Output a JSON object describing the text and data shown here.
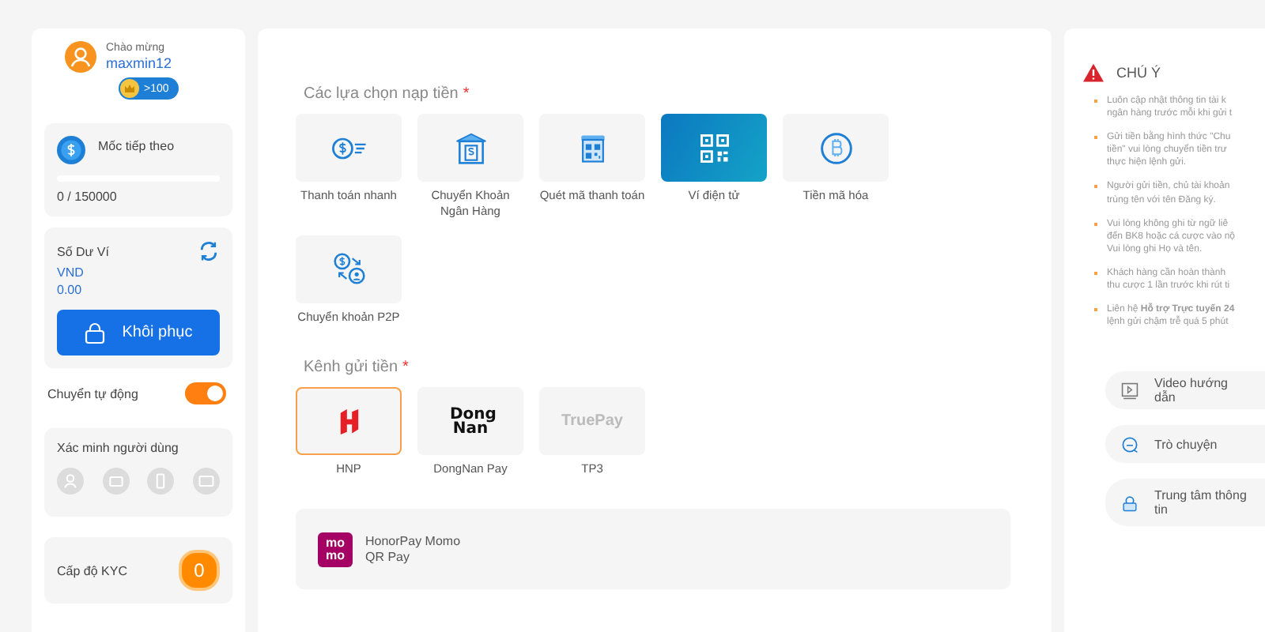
{
  "user": {
    "greeting": "Chào mừng",
    "username": "maxmin12",
    "badge": ">100"
  },
  "milestone": {
    "label": "Mốc tiếp theo",
    "level": 0,
    "progress": "0 / 150000"
  },
  "wallet": {
    "label": "Số Dư Ví",
    "currency": "VND",
    "amount": "0.00",
    "button": "Khôi phục"
  },
  "auto_transfer": {
    "label": "Chuyển tự động",
    "on": true
  },
  "verification": {
    "label": "Xác minh người dùng",
    "items": [
      {
        "kind": "person",
        "verified": false
      },
      {
        "kind": "mail",
        "verified": false
      },
      {
        "kind": "phone",
        "verified": false
      },
      {
        "kind": "card",
        "verified": false
      }
    ]
  },
  "kyc": {
    "label": "Cấp độ KYC",
    "value": "0"
  },
  "deposit_options": {
    "title": "Các lựa chọn nạp tiền",
    "required_mark": "*",
    "items": [
      {
        "kind": "fast",
        "label": "Thanh toán nhanh",
        "selected": false
      },
      {
        "kind": "bank",
        "label": "Chuyển Khoản Ngân Hàng",
        "selected": false
      },
      {
        "kind": "scan",
        "label": "Quét mã thanh toán",
        "selected": false
      },
      {
        "kind": "qr",
        "label": "Ví điện tử",
        "selected": true
      },
      {
        "kind": "crypto",
        "label": "Tiền mã hóa",
        "selected": false
      },
      {
        "kind": "p2p",
        "label": "Chuyển khoản P2P",
        "selected": false
      }
    ]
  },
  "channels": {
    "title": "Kênh gửi tiền",
    "required_mark": "*",
    "items": [
      {
        "kind": "hnp",
        "label": "HNP",
        "selected": true
      },
      {
        "kind": "dongnan",
        "logo_text": "Dong Nan",
        "label": "DongNan Pay",
        "selected": false
      },
      {
        "kind": "truepay",
        "logo_text": "TruePay",
        "label": "TP3",
        "selected": false
      }
    ]
  },
  "payment_method": {
    "logo_lines": [
      "mo",
      "mo"
    ],
    "title": "HonorPay Momo",
    "subtitle": "QR Pay"
  },
  "notice": {
    "title": "CHÚ Ý",
    "notes": [
      {
        "lines": [
          "Luôn cập nhật thông tin tài k",
          "ngân hàng trước mỗi khi gửi t"
        ]
      },
      {
        "lines": [
          "Gửi tiền bằng hình thức \"Chu",
          "tiền\" vui lòng chuyển tiền trư",
          "thực hiện lệnh gửi."
        ]
      },
      {
        "lines": [
          "Người gửi tiền, chủ tài khoản",
          "trùng tên với tên Đăng ký."
        ]
      },
      {
        "lines": [
          "Vui lòng không ghi từ ngữ liê",
          "đến BK8 hoặc cá cược vào nộ",
          "Vui lòng ghi Họ và tên."
        ]
      },
      {
        "lines": [
          "Khách hàng cần hoàn thành",
          "thu cược 1 lần trước khi rút ti"
        ]
      },
      {
        "lines": [
          "Liên hệ **Hỗ trợ Trực tuyến 24**",
          "lệnh gửi chậm trễ quá 5 phút"
        ]
      }
    ]
  },
  "help_links": [
    {
      "kind": "video",
      "label": "Video hướng dẫn"
    },
    {
      "kind": "chat",
      "label": "Trò chuyện"
    },
    {
      "kind": "info",
      "label": "Trung tâm thông tin"
    }
  ]
}
